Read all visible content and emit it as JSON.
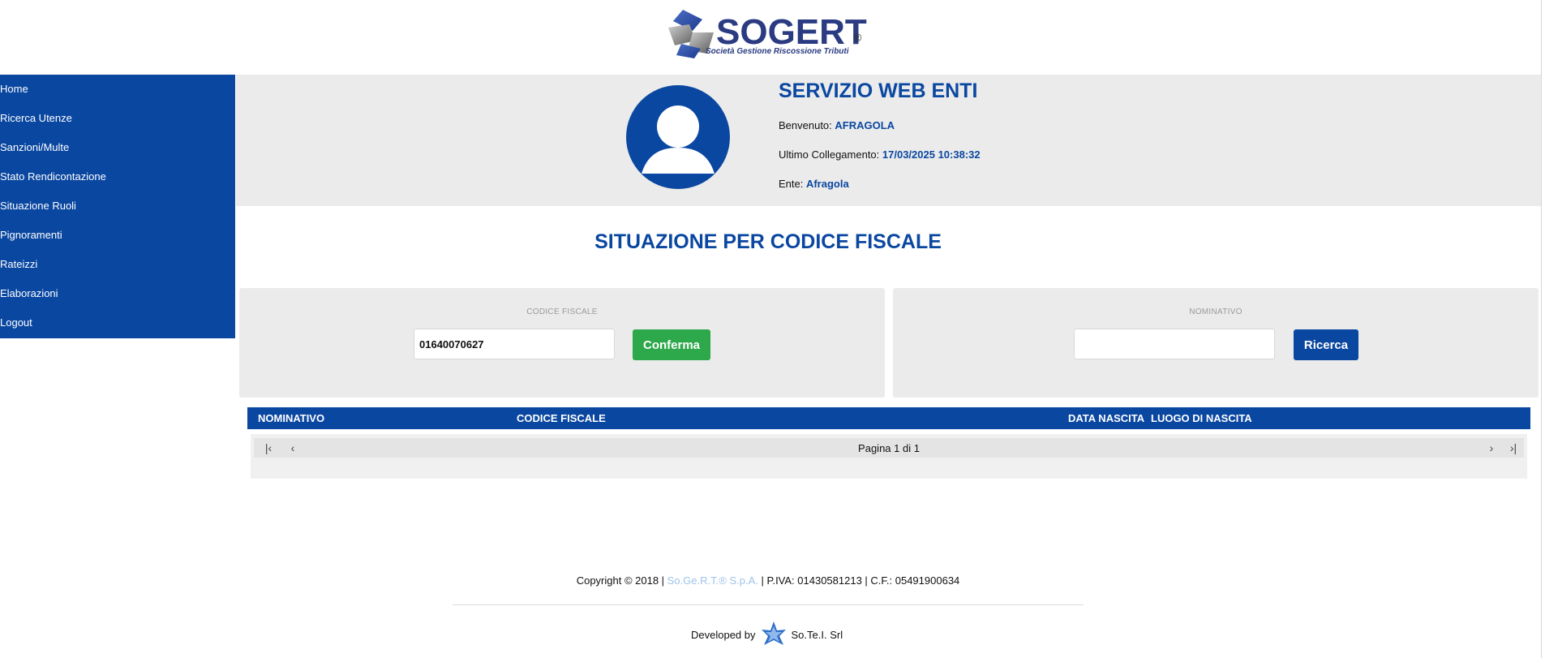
{
  "header": {
    "logo_word": "SOGERT",
    "logo_reg": "®",
    "logo_tagline": "Società Gestione Riscossione Tributi"
  },
  "sidebar": {
    "items": [
      {
        "label": "Home"
      },
      {
        "label": "Ricerca Utenze"
      },
      {
        "label": "Sanzioni/Multe"
      },
      {
        "label": "Stato Rendicontazione"
      },
      {
        "label": "Situazione Ruoli"
      },
      {
        "label": "Pignoramenti"
      },
      {
        "label": "Rateizzi"
      },
      {
        "label": "Elaborazioni"
      },
      {
        "label": "Logout"
      }
    ]
  },
  "profile": {
    "title": "SERVIZIO WEB ENTI",
    "welcome_label": "Benvenuto: ",
    "welcome_value": "AFRAGOLA",
    "last_login_label": "Ultimo Collegamento: ",
    "last_login_value": "17/03/2025 10:38:32",
    "ente_label": "Ente: ",
    "ente_value": "Afragola"
  },
  "page_title": "SITUAZIONE PER CODICE FISCALE",
  "search": {
    "codice_fiscale": {
      "label": "CODICE FISCALE",
      "value": "01640070627",
      "button": "Conferma"
    },
    "nominativo": {
      "label": "NOMINATIVO",
      "value": "",
      "button": "Ricerca"
    }
  },
  "table": {
    "headers": [
      "NOMINATIVO",
      "CODICE FISCALE",
      "DATA NASCITA",
      "LUOGO DI NASCITA"
    ],
    "rows": [],
    "pager": {
      "text": "Pagina 1 di 1"
    }
  },
  "footer": {
    "copyright_pre": "Copyright © 2018 | ",
    "company": "So.Ge.R.T.® S.p.A.",
    "copyright_post": " | P.IVA: 01430581213 | C.F.: 05491900634",
    "developed_by": "Developed by",
    "developer": "So.Te.I. Srl"
  },
  "colors": {
    "primary": "#0a47a1",
    "confirm": "#2da84a",
    "panel_bg": "#ebebeb"
  },
  "icons": {
    "avatar": "user-silhouette-icon",
    "pager_first": "first-page-icon",
    "pager_prev": "prev-page-icon",
    "pager_next": "next-page-icon",
    "pager_last": "last-page-icon"
  }
}
